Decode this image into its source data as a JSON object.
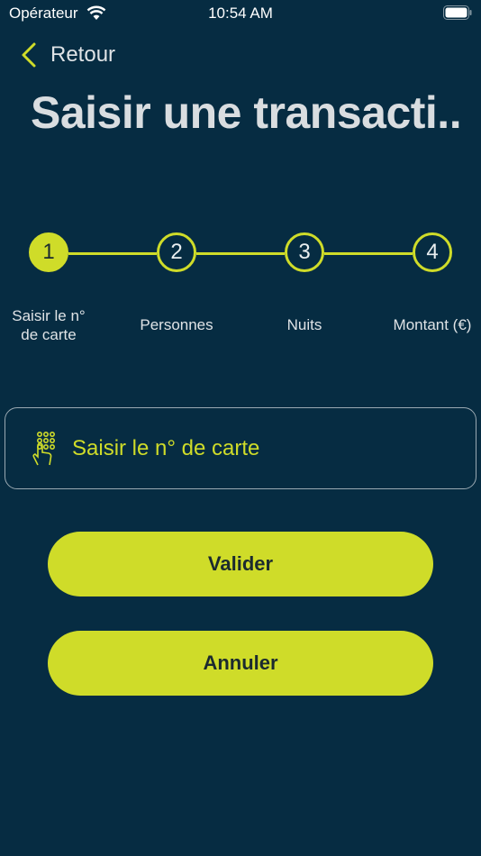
{
  "status_bar": {
    "carrier": "Opérateur",
    "time": "10:54 AM"
  },
  "nav": {
    "back_label": "Retour"
  },
  "page": {
    "title": "Saisir une transacti..."
  },
  "stepper": {
    "current_step": 1,
    "steps": [
      {
        "number": "1",
        "label": "Saisir le n°\nde carte"
      },
      {
        "number": "2",
        "label": "Personnes"
      },
      {
        "number": "3",
        "label": "Nuits"
      },
      {
        "number": "4",
        "label": "Montant (€)"
      }
    ]
  },
  "card_input": {
    "placeholder": "Saisir le n° de carte",
    "icon": "keypad-tap-icon"
  },
  "actions": {
    "validate_label": "Valider",
    "cancel_label": "Annuler"
  },
  "colors": {
    "background": "#062c42",
    "accent": "#cfdc29",
    "title": "#d9dde0"
  }
}
